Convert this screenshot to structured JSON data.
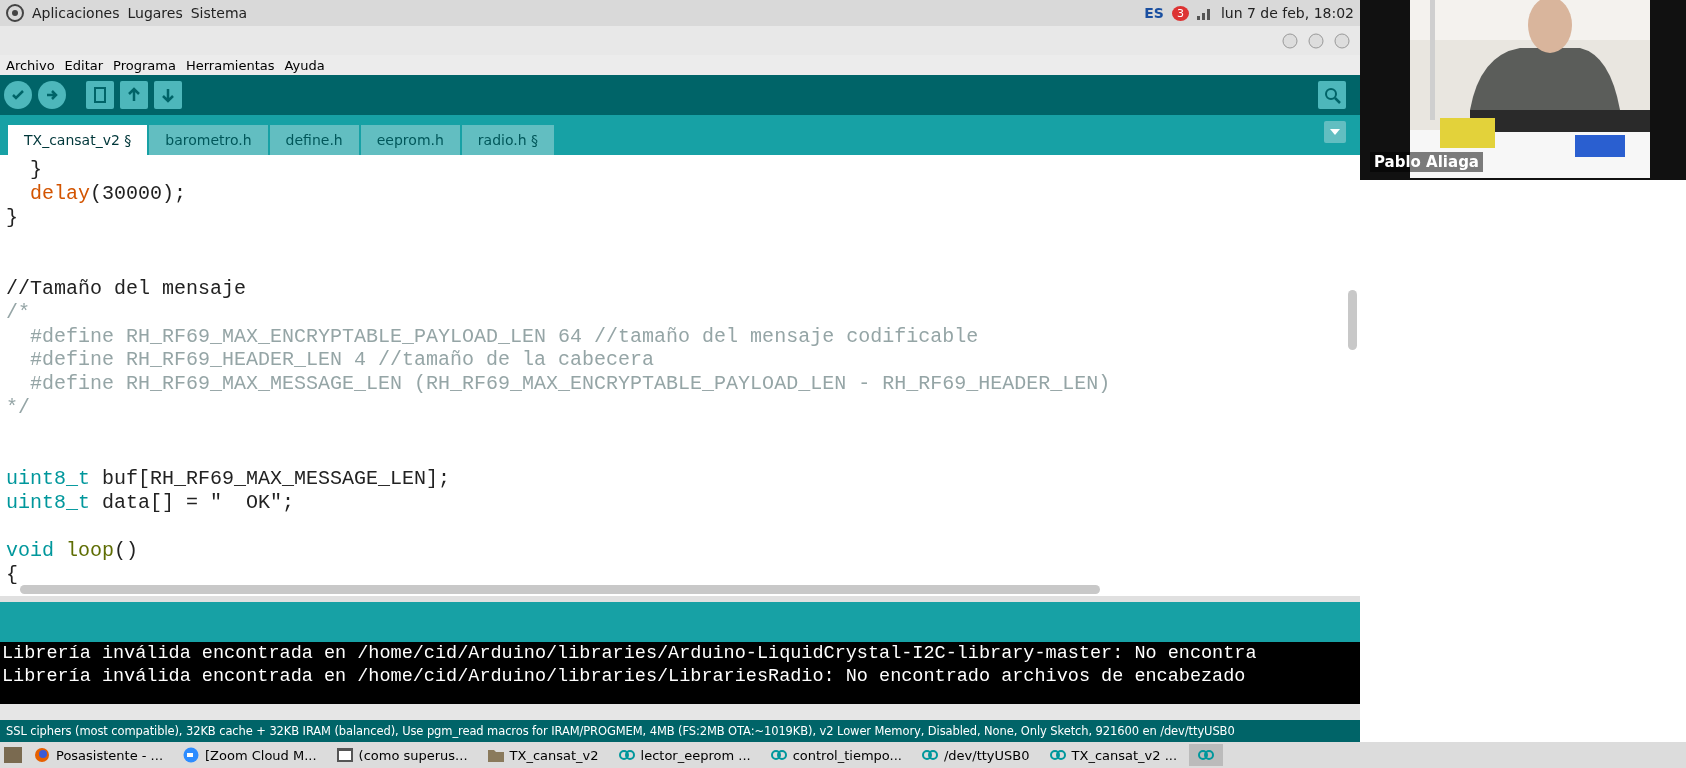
{
  "top_panel": {
    "menus": [
      "Aplicaciones",
      "Lugares",
      "Sistema"
    ],
    "keyboard": "ES",
    "notification_count": "3",
    "clock": "lun 7 de feb, 18:02"
  },
  "menu_bar": [
    "Archivo",
    "Editar",
    "Programa",
    "Herramientas",
    "Ayuda"
  ],
  "tabs": [
    {
      "label": "TX_cansat_v2 §",
      "selected": true
    },
    {
      "label": "barometro.h",
      "selected": false
    },
    {
      "label": "define.h",
      "selected": false
    },
    {
      "label": "eeprom.h",
      "selected": false
    },
    {
      "label": "radio.h §",
      "selected": false
    }
  ],
  "editor": {
    "lines": [
      {
        "kind": "code",
        "segments": [
          {
            "text": "  }",
            "kind": "plain"
          }
        ]
      },
      {
        "kind": "code",
        "segments": [
          {
            "text": "  delay",
            "kind": "func"
          },
          {
            "text": "(30000);",
            "kind": "plain"
          }
        ]
      },
      {
        "kind": "code",
        "segments": [
          {
            "text": "}",
            "kind": "plain"
          }
        ]
      },
      {
        "kind": "blank"
      },
      {
        "kind": "blank"
      },
      {
        "kind": "code",
        "segments": [
          {
            "text": "//Tamaño del mensaje",
            "kind": "plain"
          }
        ]
      },
      {
        "kind": "code",
        "segments": [
          {
            "text": "/*",
            "kind": "comment"
          }
        ]
      },
      {
        "kind": "code",
        "segments": [
          {
            "text": "  #define RH_RF69_MAX_ENCRYPTABLE_PAYLOAD_LEN 64 //tamaño del mensaje codificable",
            "kind": "comment"
          }
        ]
      },
      {
        "kind": "code",
        "segments": [
          {
            "text": "  #define RH_RF69_HEADER_LEN 4 //tamaño de la cabecera",
            "kind": "comment"
          }
        ]
      },
      {
        "kind": "code",
        "segments": [
          {
            "text": "  #define RH_RF69_MAX_MESSAGE_LEN (RH_RF69_MAX_ENCRYPTABLE_PAYLOAD_LEN - RH_RF69_HEADER_LEN)",
            "kind": "comment"
          }
        ]
      },
      {
        "kind": "code",
        "segments": [
          {
            "text": "*/",
            "kind": "comment"
          }
        ]
      },
      {
        "kind": "blank"
      },
      {
        "kind": "blank"
      },
      {
        "kind": "code",
        "segments": [
          {
            "text": "uint8_t",
            "kind": "type"
          },
          {
            "text": " buf[RH_RF69_MAX_MESSAGE_LEN];",
            "kind": "plain"
          }
        ]
      },
      {
        "kind": "code",
        "segments": [
          {
            "text": "uint8_t",
            "kind": "type"
          },
          {
            "text": " data[] = \"  OK\";",
            "kind": "plain"
          }
        ]
      },
      {
        "kind": "blank"
      },
      {
        "kind": "code",
        "segments": [
          {
            "text": "void",
            "kind": "type"
          },
          {
            "text": " loop",
            "kind": "func2"
          },
          {
            "text": "()",
            "kind": "plain"
          }
        ]
      },
      {
        "kind": "code",
        "segments": [
          {
            "text": "{",
            "kind": "plain"
          }
        ]
      }
    ]
  },
  "console": {
    "lines": [
      "Librería inválida encontrada en /home/cid/Arduino/libraries/Arduino-LiquidCrystal-I2C-library-master: No encontra",
      "Librería inválida encontrada en /home/cid/Arduino/libraries/LibrariesRadio: No encontrado archivos de encabezado"
    ]
  },
  "status_bar": "SSL ciphers (most compatible), 32KB cache + 32KB IRAM (balanced), Use pgm_read macros for IRAM/PROGMEM, 4MB (FS:2MB OTA:~1019KB), v2 Lower Memory, Disabled, None, Only Sketch, 921600 en /dev/ttyUSB0",
  "taskbar": [
    {
      "label": "Posasistente - ...",
      "kind": "browser"
    },
    {
      "label": "[Zoom Cloud M...",
      "kind": "video"
    },
    {
      "label": "(como superus...",
      "kind": "terminal"
    },
    {
      "label": "TX_cansat_v2",
      "kind": "folder"
    },
    {
      "label": "lector_eeprom ...",
      "kind": "arduino"
    },
    {
      "label": "control_tiempo...",
      "kind": "arduino"
    },
    {
      "label": "/dev/ttyUSB0",
      "kind": "arduino"
    },
    {
      "label": "TX_cansat_v2 ...",
      "kind": "arduino"
    }
  ],
  "video": {
    "kind": "picture",
    "name": "Pablo Aliaga"
  }
}
